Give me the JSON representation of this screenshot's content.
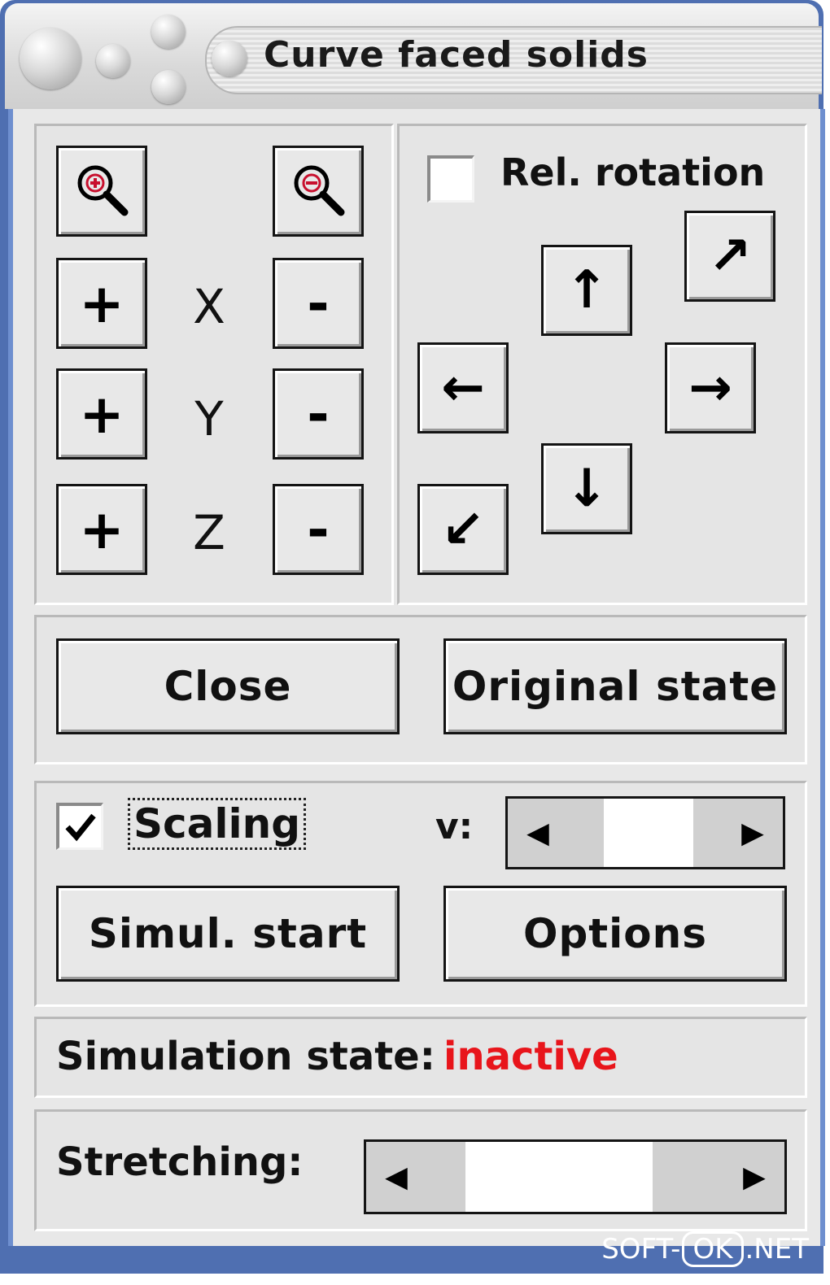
{
  "window": {
    "title": "Curve faced solids"
  },
  "zoom": {
    "in_icon": "zoom-in-icon",
    "out_icon": "zoom-out-icon"
  },
  "axes": [
    {
      "name": "X",
      "plus": "+",
      "minus": "-"
    },
    {
      "name": "Y",
      "plus": "+",
      "minus": "-"
    },
    {
      "name": "Z",
      "plus": "+",
      "minus": "-"
    }
  ],
  "rotation": {
    "relative_label": "Rel. rotation",
    "relative_checked": false,
    "arrows": {
      "up": "↑",
      "down": "↓",
      "left": "←",
      "right": "→",
      "up_right": "↗",
      "down_left": "↙"
    }
  },
  "buttons": {
    "close": "Close",
    "original_state": "Original state",
    "simul_start": "Simul. start",
    "options": "Options"
  },
  "scaling": {
    "label": "Scaling",
    "checked": true,
    "v_label": "v:",
    "v_value": 0.55
  },
  "simulation": {
    "label": "Simulation state:",
    "value": "inactive",
    "value_color": "#e8151b"
  },
  "stretching": {
    "label": "Stretching:",
    "value": 0.35
  },
  "watermark": {
    "left": "SOFT-",
    "mid": "OK",
    "right": ".NET"
  },
  "colors": {
    "titlebar_frame": "#4f6fb1",
    "panel_bg": "#e5e5e5",
    "status_inactive": "#e8151b"
  }
}
